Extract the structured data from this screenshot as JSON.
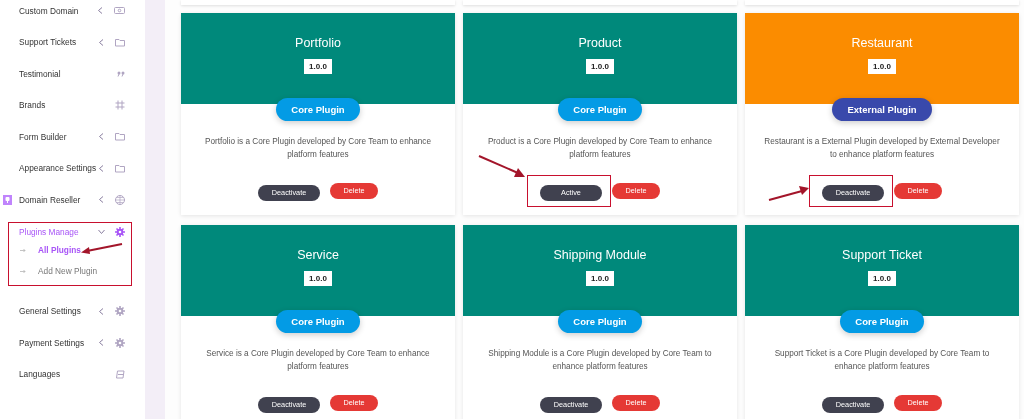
{
  "sidebar": {
    "items": [
      {
        "label": "Custom Domain",
        "expanded": false,
        "selected": false,
        "highlighted": false
      },
      {
        "label": "Support Tickets",
        "expanded": false,
        "selected": false,
        "highlighted": false
      },
      {
        "label": "Testimonial",
        "selected": false,
        "highlighted": false
      },
      {
        "label": "Brands",
        "selected": false,
        "highlighted": false
      },
      {
        "label": "Form Builder",
        "expanded": false,
        "selected": false,
        "highlighted": false
      },
      {
        "label": "Appearance Settings",
        "expanded": false,
        "selected": false,
        "highlighted": false
      },
      {
        "label": "Domain Reseller",
        "expanded": false,
        "selected": false,
        "highlighted": false
      },
      {
        "label": "Plugins Manage",
        "expanded": true,
        "selected": true,
        "highlighted": true,
        "children": [
          {
            "label": "All Plugins",
            "selected": true,
            "pointed": true
          },
          {
            "label": "Add New Plugin",
            "selected": false,
            "pointed": false
          }
        ]
      },
      {
        "label": "General Settings",
        "expanded": false,
        "selected": false,
        "highlighted": false
      },
      {
        "label": "Payment Settings",
        "expanded": false,
        "selected": false,
        "highlighted": false
      },
      {
        "label": "Languages",
        "selected": false,
        "highlighted": false
      }
    ]
  },
  "plugins": [
    {
      "title": "Portfolio",
      "version": "1.0.0",
      "color": "#00897b",
      "kind": "core",
      "badge": "Core Plugin",
      "description": "Portfolio is a Core Plugin developed by Core Team to enhance platform features",
      "primary": "Deactivate",
      "secondary": "Delete",
      "highlighted": false
    },
    {
      "title": "Product",
      "version": "1.0.0",
      "color": "#00897b",
      "kind": "core",
      "badge": "Core Plugin",
      "description": "Product is a Core Plugin developed by Core Team to enhance platform features",
      "primary": "Active",
      "secondary": "Delete",
      "highlighted": true
    },
    {
      "title": "Restaurant",
      "version": "1.0.0",
      "color": "#fb8c00",
      "kind": "external",
      "badge": "External Plugin",
      "description": "Restaurant is a External Plugin developed by External Developer to enhance platform features",
      "primary": "Deactivate",
      "secondary": "Delete",
      "highlighted": true
    },
    {
      "title": "Service",
      "version": "1.0.0",
      "color": "#00897b",
      "kind": "core",
      "badge": "Core Plugin",
      "description": "Service is a Core Plugin developed by Core Team to enhance platform features",
      "primary": "Deactivate",
      "secondary": "Delete",
      "highlighted": false
    },
    {
      "title": "Shipping Module",
      "version": "1.0.0",
      "color": "#00897b",
      "kind": "core",
      "badge": "Core Plugin",
      "description": "Shipping Module is a Core Plugin developed by Core Team to enhance platform features",
      "primary": "Deactivate",
      "secondary": "Delete",
      "highlighted": false
    },
    {
      "title": "Support Ticket",
      "version": "1.0.0",
      "color": "#00897b",
      "kind": "core",
      "badge": "Core Plugin",
      "description": "Support Ticket is a Core Plugin developed by Core Team to enhance platform features",
      "primary": "Deactivate",
      "secondary": "Delete",
      "highlighted": false
    }
  ]
}
